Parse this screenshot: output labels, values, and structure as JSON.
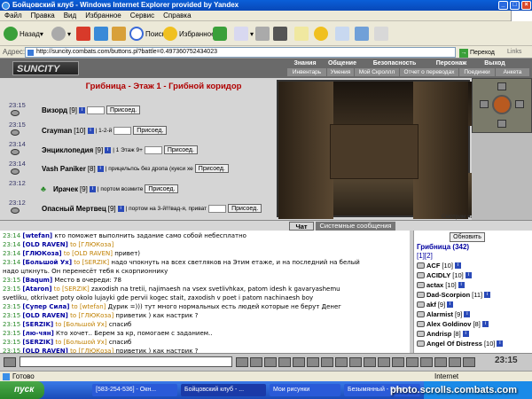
{
  "window": {
    "title": "Бойцовский клуб - Windows Internet Explorer provided by Yandex"
  },
  "menu": [
    "Файл",
    "Правка",
    "Вид",
    "Избранное",
    "Сервис",
    "Справка"
  ],
  "toolbar": {
    "back": "Назад",
    "search": "Поиск",
    "favorites": "Избранное"
  },
  "address": {
    "label": "Адрес:",
    "url": "http://suncity.combats.com/buttons.pl?battle=0.497360752434023",
    "go": "Переход",
    "links": "Links"
  },
  "game": {
    "logo": "SUNCITY",
    "nav_top": [
      "Знания",
      "Общение",
      "Безопасность",
      "Персонаж",
      "Выход"
    ],
    "nav_bottom": [
      "Инвентарь",
      "Умения",
      "Мой Скроллл",
      "Отчет о переводах",
      "Поединки",
      "Анкета"
    ]
  },
  "room": {
    "title": "Грибница - Этаж 1 - Грибной коридор",
    "caption": "Смотрим на запад"
  },
  "npcs": [
    {
      "time": "23:15",
      "name": "Визорд",
      "level": "[9]",
      "note": "",
      "btn": "Присоед."
    },
    {
      "time": "23:15",
      "name": "Crayman",
      "level": "[10]",
      "note": "| 1-2-й",
      "btn": "Присоед."
    },
    {
      "time": "23:14",
      "name": "Энциклопедия",
      "level": "[9]",
      "note": "| 1 Этаж 9+",
      "btn": "Присоед."
    },
    {
      "time": "23:14",
      "name": "Vash Paniker",
      "level": "[8]",
      "note": "| прицельпсь без дропа (кукси хе",
      "btn": "Присоед."
    },
    {
      "time": "23:12",
      "name": "Ирачек",
      "level": "[9]",
      "note": "| портом возмите",
      "btn": "Присоед."
    },
    {
      "time": "23:12",
      "name": "Опасный Мертвец",
      "level": "[9]",
      "note": "| портом на 3-й!!!вад-я, приват",
      "btn": "Присоед."
    }
  ],
  "tabs": {
    "chat": "Чат",
    "system": "Системные сообщения"
  },
  "chat": [
    {
      "time": "23:14",
      "nick": "[wtefan]",
      "to": "",
      "text": "кто поможет выполнить задание само собой небесплатно"
    },
    {
      "time": "23:14",
      "nick": "[OLD RAVEN]",
      "to": "to [ГЛЮКоза]",
      "text": ""
    },
    {
      "time": "23:14",
      "nick": "[ГЛЮКоза]",
      "to": "to [OLD RAVEN]",
      "text": "привет)"
    },
    {
      "time": "23:14",
      "nick": "[Большой Ух]",
      "to": "to [SERZIK]",
      "text": "надо чпокнуть на всех светляков на Этим етаже, и на последний на белый"
    },
    {
      "time": "",
      "nick": "",
      "to": "",
      "text": "надо цпкнуть. Он перенесёт тебя к скорпионнику"
    },
    {
      "time": "23:15",
      "nick": "[Baqum]",
      "to": "",
      "text": "Место в очереди: 78"
    },
    {
      "time": "23:15",
      "nick": "[Ataron]",
      "to": "to [SERZIK]",
      "text": "zaxodish na tretii, najimaesh na vsex svetlivhkax, patom idesh k gavaryashemu"
    },
    {
      "time": "",
      "nick": "",
      "to": "",
      "text": "svetliku, otkrivaet poty okolo lujayki gde pervii kogec stait, zaxodish v poet i patom nachinaesh boy"
    },
    {
      "time": "23:15",
      "nick": "[Супер Сила]",
      "to": "to [wtefan]",
      "text": "Дурик =))) тут много нормальных есть людей которые не берут Денег"
    },
    {
      "time": "23:15",
      "nick": "[OLD RAVEN]",
      "to": "to [ГЛЮКоза]",
      "text": "приветик ) как настрик ?"
    },
    {
      "time": "23:15",
      "nick": "[SERZIK]",
      "to": "to [Большой Ух]",
      "text": "спасиб"
    },
    {
      "time": "23:15",
      "nick": "[лю-чян]",
      "to": "",
      "text": "Кто хочет.. Берем за кр, помогаем с заданием.."
    },
    {
      "time": "23:15",
      "nick": "[SERZIK]",
      "to": "to [Большой Ух]",
      "text": "спасиб"
    },
    {
      "time": "23:15",
      "nick": "[OLD RAVEN]",
      "to": "to [ГЛЮКоза]",
      "text": "приветик ) как настрик ?"
    }
  ],
  "userlist": {
    "refresh": "Обновить",
    "header": "Грибница (342)",
    "pages": "[1][2]",
    "users": [
      {
        "name": "ACF",
        "level": "[10]"
      },
      {
        "name": "ACIDLY",
        "level": "[10]"
      },
      {
        "name": "actax",
        "level": "[10]"
      },
      {
        "name": "Dad-Scorpion",
        "level": "[11]"
      },
      {
        "name": "akf",
        "level": "[9]"
      },
      {
        "name": "Alarmist",
        "level": "[9]"
      },
      {
        "name": "Alex Goldinov",
        "level": "[8]"
      },
      {
        "name": "Andrisp",
        "level": "[8]"
      },
      {
        "name": "Angel Of Distress",
        "level": "[10]"
      }
    ]
  },
  "clock": "23:15",
  "status": {
    "left": "Готово",
    "zone": "Internet"
  },
  "taskbar": {
    "start": "пуск",
    "items": [
      "[583-254-536] - Окн...",
      "Бойцовский клуб - ...",
      "Мои рисунки",
      "Безымянный - Paint"
    ]
  },
  "watermark": "photo.scrolls.combats.com"
}
